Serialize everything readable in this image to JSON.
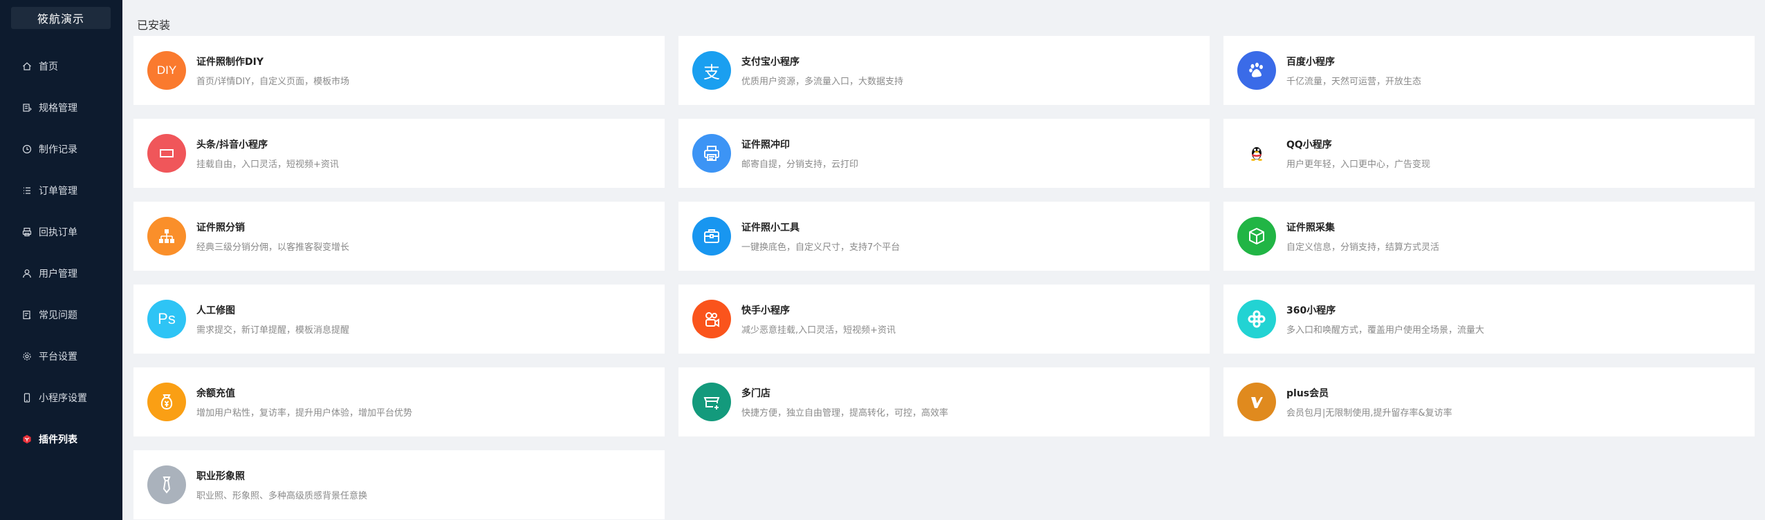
{
  "brand": "筱航演示",
  "menu": [
    {
      "label": "首页",
      "icon": "home-icon",
      "active": false
    },
    {
      "label": "规格管理",
      "icon": "spec-icon",
      "active": false
    },
    {
      "label": "制作记录",
      "icon": "clock-icon",
      "active": false
    },
    {
      "label": "订单管理",
      "icon": "order-list-icon",
      "active": false
    },
    {
      "label": "回执订单",
      "icon": "receipt-icon",
      "active": false
    },
    {
      "label": "用户管理",
      "icon": "user-icon",
      "active": false
    },
    {
      "label": "常见问题",
      "icon": "faq-icon",
      "active": false
    },
    {
      "label": "平台设置",
      "icon": "gear-icon",
      "active": false
    },
    {
      "label": "小程序设置",
      "icon": "phone-icon",
      "active": false
    },
    {
      "label": "插件列表",
      "icon": "plugin-icon",
      "active": true
    }
  ],
  "section_title": "已安装",
  "plugins": [
    {
      "name": "证件照制作DIY",
      "desc": "首页/详情DIY，自定义页面，模板市场",
      "icon": "diy-icon",
      "color": "#fa7a2e"
    },
    {
      "name": "支付宝小程序",
      "desc": "优质用户资源，多流量入口，大数据支持",
      "icon": "alipay-icon",
      "color": "#1a9ff0"
    },
    {
      "name": "百度小程序",
      "desc": "千亿流量，天然可运营，开放生态",
      "icon": "baidu-paw-icon",
      "color": "#3a6be8"
    },
    {
      "name": "头条/抖音小程序",
      "desc": "挂载自由，入口灵活，短视频+资讯",
      "icon": "toutiao-icon",
      "color": "#f0565a"
    },
    {
      "name": "证件照冲印",
      "desc": "邮寄自提，分销支持，云打印",
      "icon": "printer-icon",
      "color": "#3c94f5"
    },
    {
      "name": "QQ小程序",
      "desc": "用户更年轻，入口更中心，广告变现",
      "icon": "qq-penguin-icon",
      "color": "#ffffff"
    },
    {
      "name": "证件照分销",
      "desc": "经典三级分销分佣，以客推客裂变增长",
      "icon": "distribution-icon",
      "color": "#fa8f2a"
    },
    {
      "name": "证件照小工具",
      "desc": "一键换底色，自定义尺寸，支持7个平台",
      "icon": "toolbox-icon",
      "color": "#1896f0"
    },
    {
      "name": "证件照采集",
      "desc": "自定义信息，分销支持，结算方式灵活",
      "icon": "box-icon",
      "color": "#21b545"
    },
    {
      "name": "人工修图",
      "desc": "需求提交，新订单提醒，模板消息提醒",
      "icon": "ps-icon",
      "color": "#2ec4f5"
    },
    {
      "name": "快手小程序",
      "desc": "减少恶意挂载,入口灵活，短视频+资讯",
      "icon": "kuaishou-icon",
      "color": "#fa541c"
    },
    {
      "name": "360小程序",
      "desc": "多入口和唤醒方式，覆盖用户使用全场景，流量大",
      "icon": "360-icon",
      "color": "#22d3d3"
    },
    {
      "name": "余额充值",
      "desc": "增加用户粘性，复访率，提升用户体验，增加平台优势",
      "icon": "money-bag-icon",
      "color": "#fa9f14"
    },
    {
      "name": "多门店",
      "desc": "快捷方便，独立自由管理，提高转化，可控，高效率",
      "icon": "multi-store-icon",
      "color": "#139a7c"
    },
    {
      "name": "plus会员",
      "desc": "会员包月|无限制使用,提升留存率&复访率",
      "icon": "vip-icon",
      "color": "#e08a1e"
    },
    {
      "name": "职业形象照",
      "desc": "职业照、形象照、多种高级质感背景任意换",
      "icon": "tie-icon",
      "color": "#aab2bc"
    }
  ]
}
